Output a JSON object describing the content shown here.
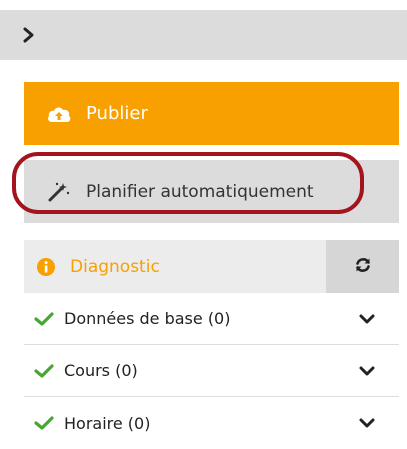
{
  "topbar": {
    "toggle_icon": "chevron-right-icon"
  },
  "publish": {
    "label": "Publier",
    "icon": "cloud-upload-icon",
    "color": "#f7a000"
  },
  "planifier": {
    "label": "Planifier automatiquement",
    "icon": "magic-wand-icon"
  },
  "diagnostic": {
    "title": "Diagnostic",
    "icon": "info-circle-icon",
    "refresh_icon": "refresh-icon",
    "items": [
      {
        "label": "Données de base (0)",
        "status_icon": "check-icon",
        "expand_icon": "chevron-down-icon"
      },
      {
        "label": "Cours (0)",
        "status_icon": "check-icon",
        "expand_icon": "chevron-down-icon"
      },
      {
        "label": "Horaire (0)",
        "status_icon": "check-icon",
        "expand_icon": "chevron-down-icon"
      }
    ]
  },
  "colors": {
    "accent": "#f7a000",
    "check": "#46a832",
    "highlight": "#a3141f"
  }
}
